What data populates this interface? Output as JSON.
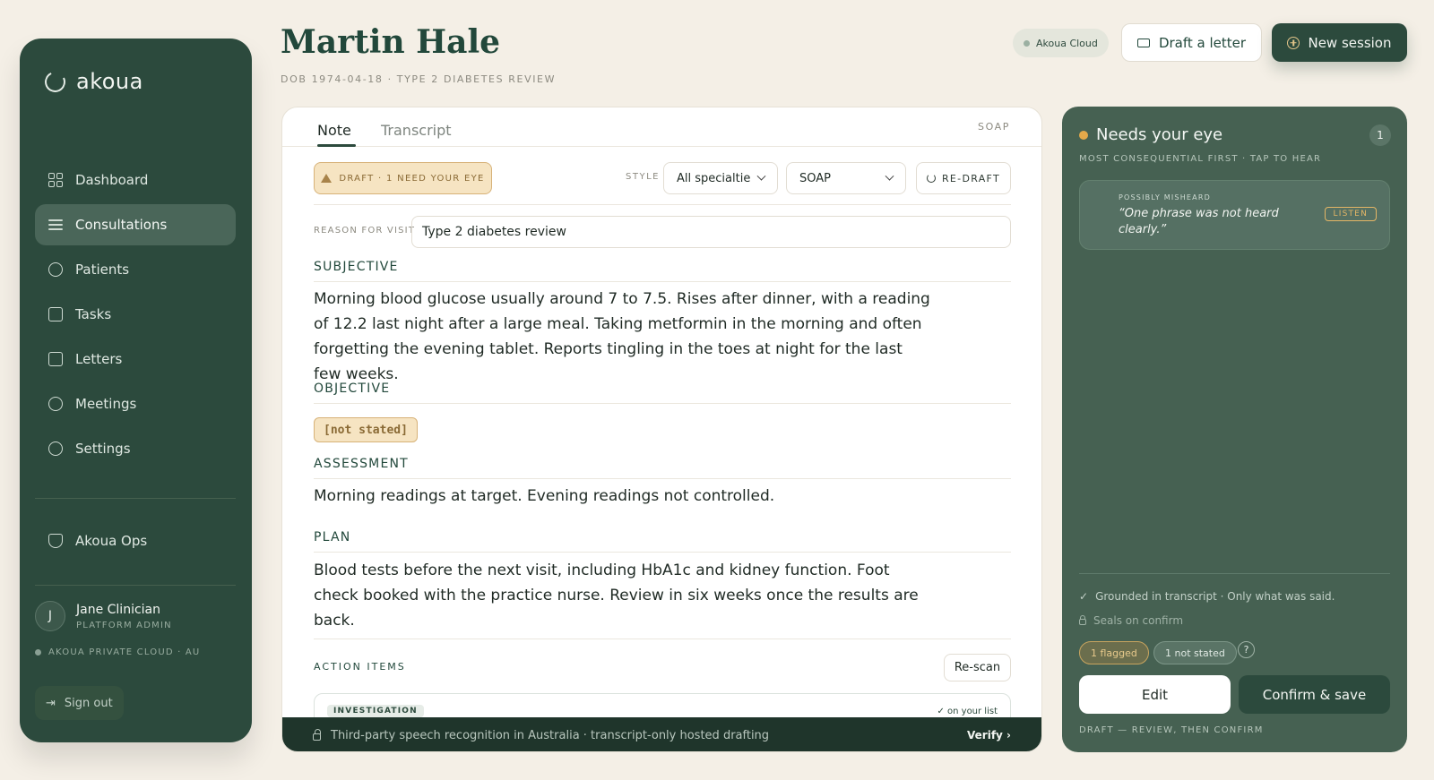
{
  "app": {
    "name": "akoua"
  },
  "nav": {
    "items": [
      {
        "label": "Dashboard",
        "icon": "dashboard-icon"
      },
      {
        "label": "Consultations",
        "icon": "list-icon",
        "active": true
      },
      {
        "label": "Patients",
        "icon": "users-icon"
      },
      {
        "label": "Tasks",
        "icon": "checkbox-icon"
      },
      {
        "label": "Letters",
        "icon": "mail-icon"
      },
      {
        "label": "Meetings",
        "icon": "people-icon"
      },
      {
        "label": "Settings",
        "icon": "gear-icon"
      }
    ],
    "ops_label": "Akoua Ops"
  },
  "user": {
    "initial": "J",
    "name": "Jane Clinician",
    "role": "PLATFORM ADMIN",
    "cloud": "AKOUA PRIVATE CLOUD · AU",
    "signout": "Sign out"
  },
  "header": {
    "patient_name": "Martin Hale",
    "patient_meta": "DOB 1974-04-18 · TYPE 2 DIABETES REVIEW",
    "cloud_pill": "Akoua Cloud",
    "draft_letter": "Draft a letter",
    "new_session": "New session"
  },
  "note": {
    "tabs": [
      "Note",
      "Transcript"
    ],
    "format_tag": "SOAP",
    "draft_badge": "DRAFT · 1 NEED YOUR EYE",
    "style_label": "STYLE",
    "style_value": "All specialtie",
    "format_value": "SOAP",
    "redraft": "RE-DRAFT",
    "reason_label": "REASON FOR VISIT",
    "reason_value": "Type 2 diabetes review",
    "subjective_title": "SUBJECTIVE",
    "subjective_text": "Morning blood glucose usually around 7 to 7.5. Rises after dinner, with a reading of 12.2 last night after a large meal. Taking metformin in the morning and often forgetting the evening tablet. Reports tingling in the toes at night for the last few weeks.",
    "objective_title": "OBJECTIVE",
    "objective_value": "[not stated]",
    "assessment_title": "ASSESSMENT",
    "assessment_text": "Morning readings at target. Evening readings not controlled.",
    "plan_title": "PLAN",
    "plan_text": "Blood tests before the next visit, including HbA1c and kidney function. Foot check booked with the practice nurse. Review in six weeks once the results are back.",
    "action_items_title": "ACTION ITEMS",
    "rescan": "Re-scan",
    "action_tag": "INVESTIGATION",
    "action_status": "✓ on your list",
    "footer_text": "Third-party speech recognition in Australia · transcript-only hosted drafting",
    "verify": "Verify ›"
  },
  "review": {
    "title": "Needs your eye",
    "count": "1",
    "subtitle": "MOST CONSEQUENTIAL FIRST · TAP TO HEAR",
    "item_label": "POSSIBLY MISHEARD",
    "item_quote": "“One phrase was not heard clearly.”",
    "listen": "LISTEN",
    "grounded": "Grounded in transcript · Only what was said.",
    "seals": "Seals on confirm",
    "flagged_chip": "1 flagged",
    "not_stated_chip": "1 not stated",
    "help": "?",
    "edit": "Edit",
    "confirm": "Confirm & save",
    "footer": "DRAFT — REVIEW, THEN CONFIRM"
  },
  "colors": {
    "sidebar": "#2c4a3d",
    "accent": "#22483b",
    "warning": "#f6e4c2",
    "review_panel": "#466152"
  }
}
